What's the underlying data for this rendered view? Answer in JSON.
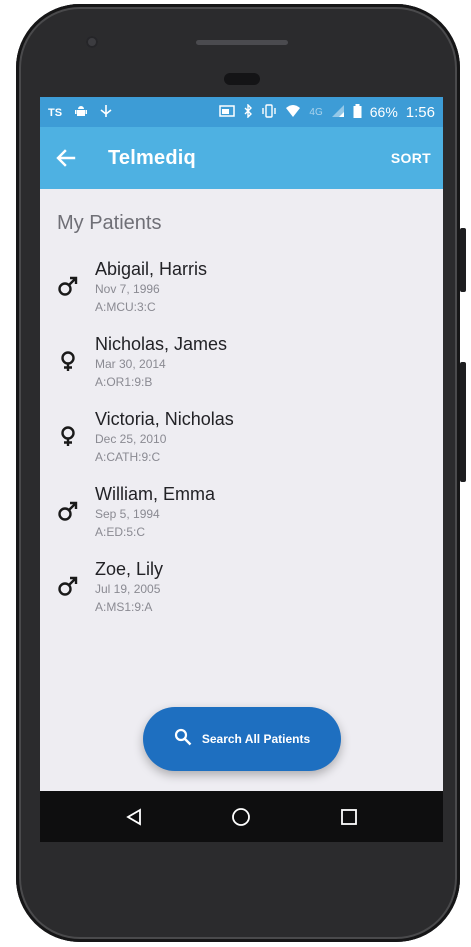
{
  "status_bar": {
    "left_icons": [
      "ts-icon",
      "android-icon",
      "usb-icon"
    ],
    "network_label": "4G",
    "battery": "66%",
    "time": "1:56"
  },
  "app_bar": {
    "title": "Telmediq",
    "sort_label": "SORT"
  },
  "section_title": "My Patients",
  "patients": [
    {
      "name": "Abigail, Harris",
      "dob": "Nov 7, 1996",
      "code": "A:MCU:3:C",
      "gender": "male"
    },
    {
      "name": "Nicholas, James",
      "dob": "Mar 30, 2014",
      "code": "A:OR1:9:B",
      "gender": "female"
    },
    {
      "name": "Victoria, Nicholas",
      "dob": "Dec 25, 2010",
      "code": "A:CATH:9:C",
      "gender": "female"
    },
    {
      "name": "William, Emma",
      "dob": "Sep 5, 1994",
      "code": "A:ED:5:C",
      "gender": "male"
    },
    {
      "name": "Zoe, Lily",
      "dob": "Jul 19, 2005",
      "code": "A:MS1:9:A",
      "gender": "male"
    }
  ],
  "fab": {
    "label": "Search All Patients"
  },
  "colors": {
    "status_bar": "#3d9cd6",
    "app_bar": "#4eb1e2",
    "fab": "#1e6fc0",
    "background": "#eeedf2"
  }
}
